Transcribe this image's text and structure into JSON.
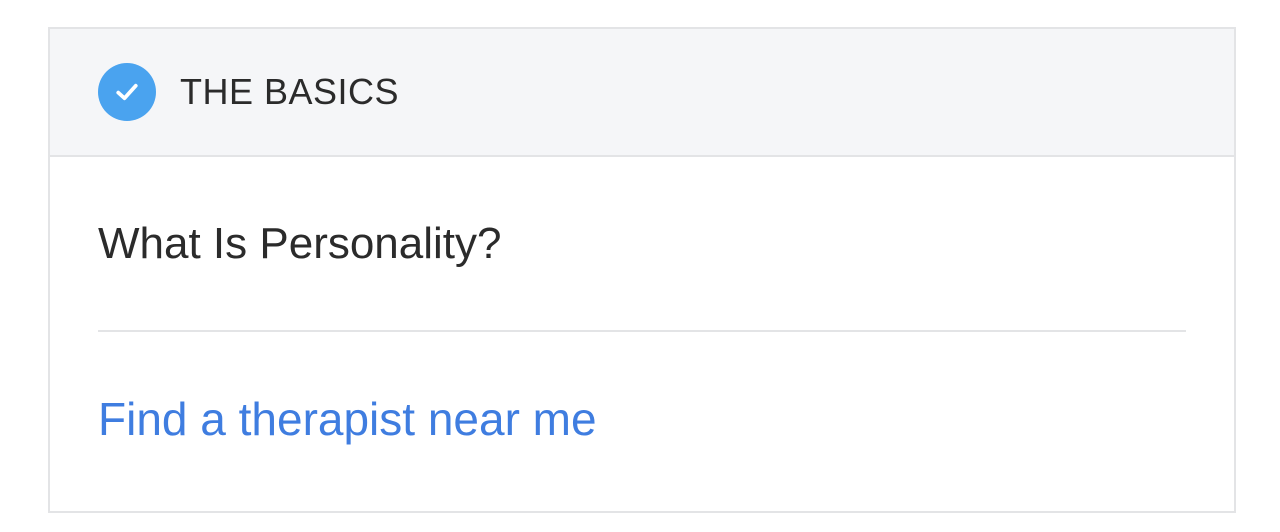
{
  "card": {
    "header": {
      "icon": "check-circle-icon",
      "title": "THE BASICS",
      "accent_color": "#4aa3ef"
    },
    "article": {
      "label": "What Is Personality?"
    },
    "cta": {
      "label": "Find a therapist near me",
      "color": "#3f7de0"
    }
  }
}
